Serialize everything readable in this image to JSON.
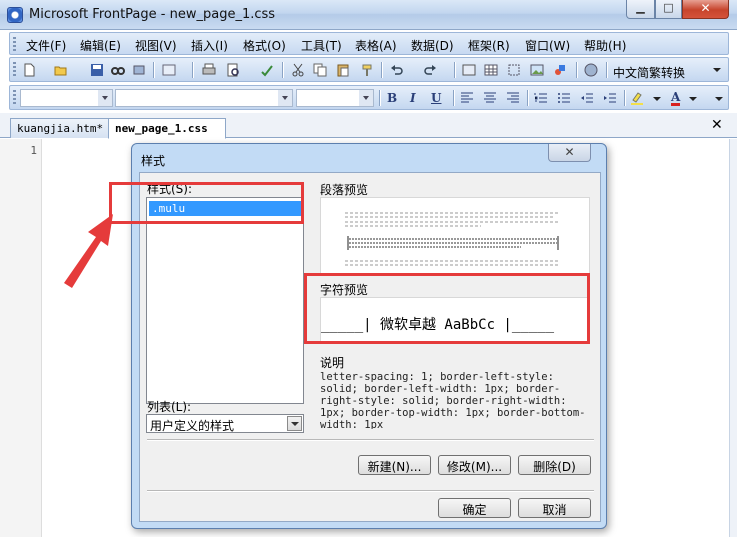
{
  "window": {
    "title": "Microsoft FrontPage - new_page_1.css",
    "minimize_glyph": "▁",
    "maximize_glyph": "□",
    "close_glyph": "✕"
  },
  "menu": [
    {
      "label": "文件(F)"
    },
    {
      "label": "编辑(E)"
    },
    {
      "label": "视图(V)"
    },
    {
      "label": "插入(I)"
    },
    {
      "label": "格式(O)"
    },
    {
      "label": "工具(T)"
    },
    {
      "label": "表格(A)"
    },
    {
      "label": "数据(D)"
    },
    {
      "label": "框架(R)"
    },
    {
      "label": "窗口(W)"
    },
    {
      "label": "帮助(H)"
    }
  ],
  "toolbar": {
    "conversion_label": "中文简繁转换",
    "bold": "B",
    "italic": "I",
    "underline": "U",
    "font_color_letter": "A"
  },
  "tabs": [
    {
      "label": "kuangjia.htm*"
    },
    {
      "label": "new_page_1.css"
    }
  ],
  "doc_close_glyph": "✕",
  "editor": {
    "line_number": "1"
  },
  "dialog": {
    "title": "样式",
    "close_glyph": "✕",
    "styles_label": "样式(S):",
    "styles": [
      ".mulu"
    ],
    "list_label": "列表(L):",
    "list_value": "用户定义的样式",
    "paragraph_preview_label": "段落预览",
    "char_preview_label": "字符预览",
    "char_preview_text": "_____|  微软卓越 AaBbCc  |_____",
    "description_label": "说明",
    "description_text": "letter-spacing: 1; border-left-style: solid; border-left-width: 1px; border-right-style: solid; border-right-width: 1px; border-top-width: 1px; border-bottom-width: 1px",
    "buttons": {
      "new": "新建(N)...",
      "modify": "修改(M)...",
      "delete": "删除(D)",
      "ok": "确定",
      "cancel": "取消"
    }
  },
  "annotation_color": "#e53b3b"
}
